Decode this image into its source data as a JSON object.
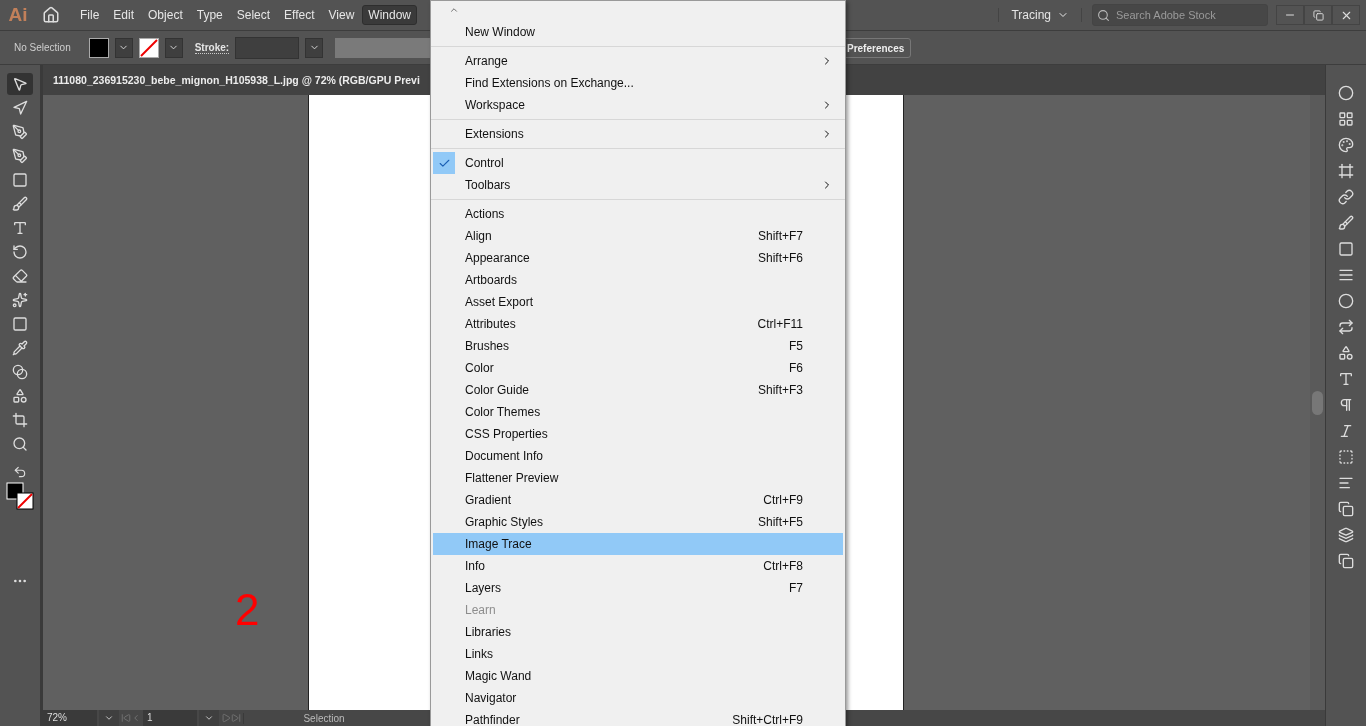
{
  "app": {
    "logo": "Ai"
  },
  "menubar": [
    {
      "label": "File",
      "selected": false
    },
    {
      "label": "Edit",
      "selected": false
    },
    {
      "label": "Object",
      "selected": false
    },
    {
      "label": "Type",
      "selected": false
    },
    {
      "label": "Select",
      "selected": false
    },
    {
      "label": "Effect",
      "selected": false
    },
    {
      "label": "View",
      "selected": false
    },
    {
      "label": "Window",
      "selected": true
    }
  ],
  "workspace": {
    "label": "Tracing"
  },
  "search": {
    "placeholder": "Search Adobe Stock"
  },
  "control_bar": {
    "selection": "No Selection",
    "stroke_label": "Stroke:",
    "preferences_button": "Preferences"
  },
  "document_tab": {
    "title": "111080_236915230_bebe_mignon_H105938_L.jpg @ 72% (RGB/GPU Previ"
  },
  "tools": [
    {
      "selected": true
    },
    {
      "selected": false
    },
    {
      "selected": false
    },
    {
      "selected": false
    },
    {
      "selected": false
    },
    {
      "selected": false
    },
    {
      "selected": false
    },
    {
      "selected": false
    },
    {
      "selected": false
    },
    {
      "selected": false
    },
    {
      "selected": false
    },
    {
      "selected": false
    },
    {
      "selected": false
    },
    {
      "selected": false
    },
    {
      "selected": false
    },
    {
      "selected": false
    }
  ],
  "annotation": {
    "text": "2",
    "color": "#ff0000"
  },
  "window_menu": {
    "groups": [
      [
        {
          "label": "New Window",
          "submenu": false,
          "checked": false,
          "disabled": false,
          "selected": false
        }
      ],
      [
        {
          "label": "Arrange",
          "submenu": true,
          "checked": false,
          "disabled": false,
          "selected": false
        },
        {
          "label": "Find Extensions on Exchange...",
          "submenu": false,
          "checked": false,
          "disabled": false,
          "selected": false
        },
        {
          "label": "Workspace",
          "submenu": true,
          "checked": false,
          "disabled": false,
          "selected": false
        }
      ],
      [
        {
          "label": "Extensions",
          "submenu": true,
          "checked": false,
          "disabled": false,
          "selected": false
        }
      ],
      [
        {
          "label": "Control",
          "submenu": false,
          "checked": true,
          "disabled": false,
          "selected": false
        },
        {
          "label": "Toolbars",
          "submenu": true,
          "checked": false,
          "disabled": false,
          "selected": false
        }
      ],
      [
        {
          "label": "Actions",
          "submenu": false,
          "checked": false,
          "disabled": false,
          "selected": false
        },
        {
          "label": "Align",
          "shortcut": "Shift+F7",
          "submenu": false,
          "checked": false,
          "disabled": false,
          "selected": false
        },
        {
          "label": "Appearance",
          "shortcut": "Shift+F6",
          "submenu": false,
          "checked": false,
          "disabled": false,
          "selected": false
        },
        {
          "label": "Artboards",
          "submenu": false,
          "checked": false,
          "disabled": false,
          "selected": false
        },
        {
          "label": "Asset Export",
          "submenu": false,
          "checked": false,
          "disabled": false,
          "selected": false
        },
        {
          "label": "Attributes",
          "shortcut": "Ctrl+F11",
          "submenu": false,
          "checked": false,
          "disabled": false,
          "selected": false
        },
        {
          "label": "Brushes",
          "shortcut": "F5",
          "submenu": false,
          "checked": false,
          "disabled": false,
          "selected": false
        },
        {
          "label": "Color",
          "shortcut": "F6",
          "submenu": false,
          "checked": false,
          "disabled": false,
          "selected": false
        },
        {
          "label": "Color Guide",
          "shortcut": "Shift+F3",
          "submenu": false,
          "checked": false,
          "disabled": false,
          "selected": false
        },
        {
          "label": "Color Themes",
          "submenu": false,
          "checked": false,
          "disabled": false,
          "selected": false
        },
        {
          "label": "CSS Properties",
          "submenu": false,
          "checked": false,
          "disabled": false,
          "selected": false
        },
        {
          "label": "Document Info",
          "submenu": false,
          "checked": false,
          "disabled": false,
          "selected": false
        },
        {
          "label": "Flattener Preview",
          "submenu": false,
          "checked": false,
          "disabled": false,
          "selected": false
        },
        {
          "label": "Gradient",
          "shortcut": "Ctrl+F9",
          "submenu": false,
          "checked": false,
          "disabled": false,
          "selected": false
        },
        {
          "label": "Graphic Styles",
          "shortcut": "Shift+F5",
          "submenu": false,
          "checked": false,
          "disabled": false,
          "selected": false
        },
        {
          "label": "Image Trace",
          "submenu": false,
          "checked": false,
          "disabled": false,
          "selected": true
        },
        {
          "label": "Info",
          "shortcut": "Ctrl+F8",
          "submenu": false,
          "checked": false,
          "disabled": false,
          "selected": false
        },
        {
          "label": "Layers",
          "shortcut": "F7",
          "submenu": false,
          "checked": false,
          "disabled": false,
          "selected": false
        },
        {
          "label": "Learn",
          "submenu": false,
          "checked": false,
          "disabled": true,
          "selected": false
        },
        {
          "label": "Libraries",
          "submenu": false,
          "checked": false,
          "disabled": false,
          "selected": false
        },
        {
          "label": "Links",
          "submenu": false,
          "checked": false,
          "disabled": false,
          "selected": false
        },
        {
          "label": "Magic Wand",
          "submenu": false,
          "checked": false,
          "disabled": false,
          "selected": false
        },
        {
          "label": "Navigator",
          "submenu": false,
          "checked": false,
          "disabled": false,
          "selected": false
        },
        {
          "label": "Pathfinder",
          "shortcut": "Shift+Ctrl+F9",
          "submenu": false,
          "checked": false,
          "disabled": false,
          "selected": false
        }
      ]
    ]
  },
  "status_bar": {
    "zoom": "72%",
    "artboard": "1",
    "tool": "Selection"
  }
}
